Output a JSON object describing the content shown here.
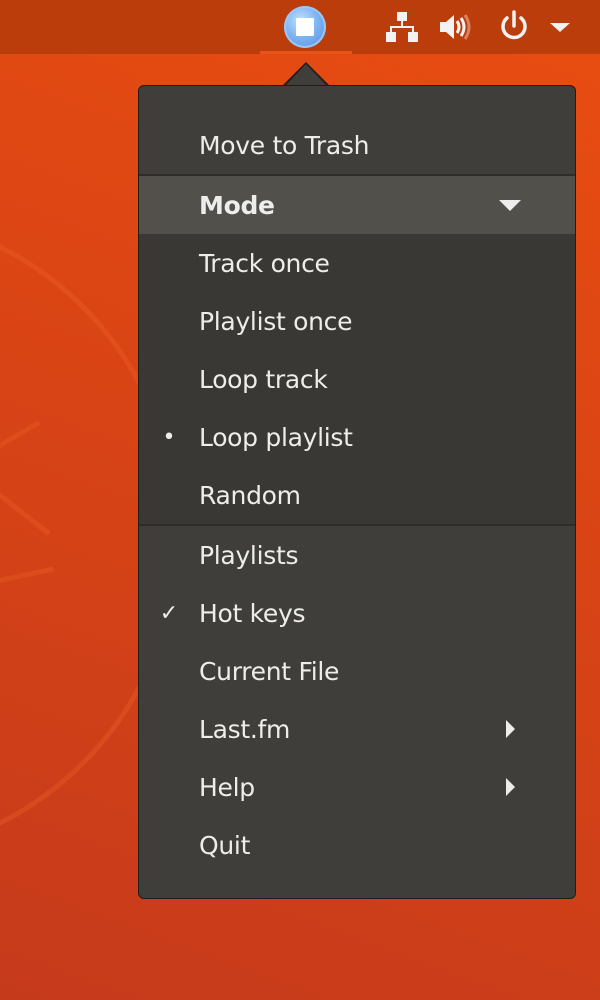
{
  "topbar": {
    "app_indicator": {
      "icon": "stop-icon",
      "name": "audio-player-indicator"
    },
    "tray": [
      {
        "icon": "network-icon"
      },
      {
        "icon": "volume-icon"
      },
      {
        "icon": "power-icon"
      },
      {
        "icon": "dropdown-arrow-icon"
      }
    ]
  },
  "menu": {
    "move_to_trash": "Move to Trash",
    "mode": {
      "label": "Mode",
      "expanded": true,
      "options": [
        {
          "label": "Track once",
          "selected": false
        },
        {
          "label": "Playlist once",
          "selected": false
        },
        {
          "label": "Loop track",
          "selected": false
        },
        {
          "label": "Loop playlist",
          "selected": true,
          "mark": "•"
        },
        {
          "label": "Random",
          "selected": false
        }
      ]
    },
    "items": [
      {
        "label": "Playlists"
      },
      {
        "label": "Hot keys",
        "checked": true,
        "mark": "✓"
      },
      {
        "label": "Current File"
      },
      {
        "label": "Last.fm",
        "submenu": true
      },
      {
        "label": "Help",
        "submenu": true
      },
      {
        "label": "Quit"
      }
    ]
  },
  "colors": {
    "wallpaper": "#DD4614",
    "topbar": "#BA3D0B",
    "active_indicator": "#E8531B",
    "menu_bg": "#3F3E3A",
    "menu_header_bg": "#52504B",
    "submenu_bg": "#393834",
    "text": "#EDEDEB"
  }
}
